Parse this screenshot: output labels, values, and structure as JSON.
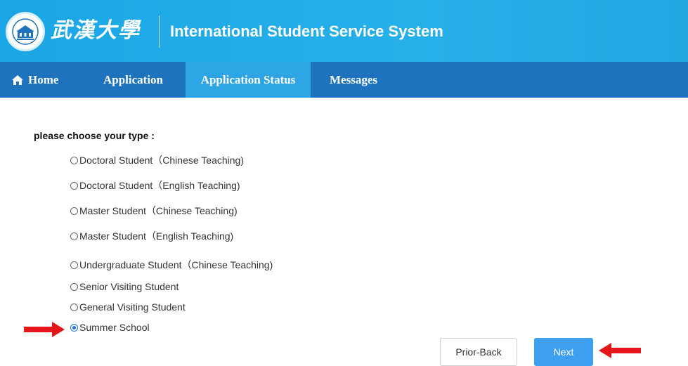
{
  "header": {
    "logo_text": "武漢大學",
    "title": "International Student Service System"
  },
  "nav": {
    "items": [
      {
        "label": "Home",
        "icon": "home-icon"
      },
      {
        "label": "Application"
      },
      {
        "label": "Application Status",
        "active": true
      },
      {
        "label": "Messages"
      }
    ]
  },
  "form": {
    "prompt": "please choose your type :",
    "options": [
      {
        "label": "Doctoral Student（Chinese Teaching)",
        "checked": false
      },
      {
        "label": "Doctoral Student（English Teaching)",
        "checked": false
      },
      {
        "label": "Master Student（Chinese Teaching)",
        "checked": false
      },
      {
        "label": "Master Student（English Teaching)",
        "checked": false
      },
      {
        "label": "Undergraduate Student（Chinese Teaching)",
        "checked": false
      },
      {
        "label": "Senior Visiting Student",
        "checked": false
      },
      {
        "label": "General Visiting Student",
        "checked": false
      },
      {
        "label": "Summer School",
        "checked": true
      }
    ]
  },
  "buttons": {
    "back_label": "Prior-Back",
    "next_label": "Next"
  },
  "colors": {
    "header_bg": "#22a7e3",
    "nav_bg": "#1e73be",
    "nav_active": "#2ea6e6",
    "next_button": "#3d9ff0",
    "annotation_arrow": "#e8141c"
  }
}
